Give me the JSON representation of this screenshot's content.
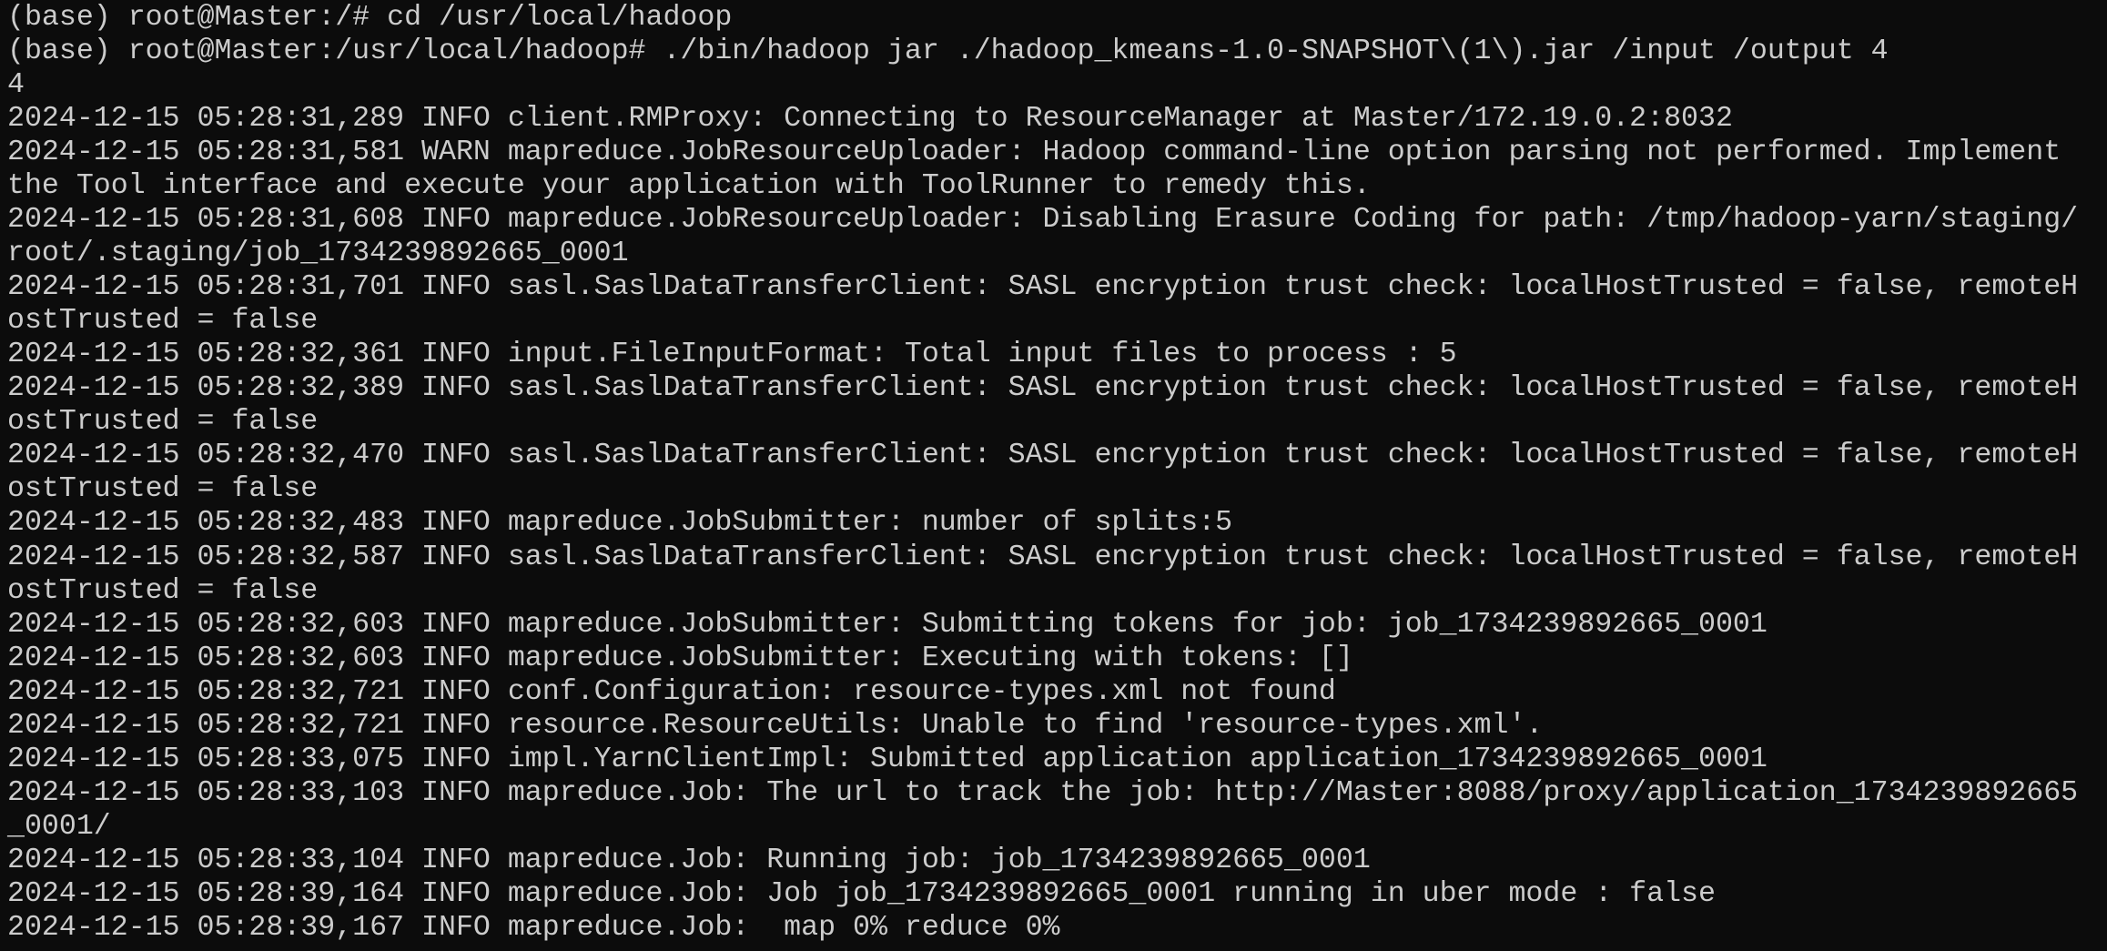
{
  "terminal": {
    "background": "#0c0c0c",
    "foreground": "#cccccc",
    "lines": [
      "(base) root@Master:/# cd /usr/local/hadoop",
      "(base) root@Master:/usr/local/hadoop# ./bin/hadoop jar ./hadoop_kmeans-1.0-SNAPSHOT\\(1\\).jar /input /output 4",
      "4",
      "2024-12-15 05:28:31,289 INFO client.RMProxy: Connecting to ResourceManager at Master/172.19.0.2:8032",
      "2024-12-15 05:28:31,581 WARN mapreduce.JobResourceUploader: Hadoop command-line option parsing not performed. Implement",
      "the Tool interface and execute your application with ToolRunner to remedy this.",
      "2024-12-15 05:28:31,608 INFO mapreduce.JobResourceUploader: Disabling Erasure Coding for path: /tmp/hadoop-yarn/staging/",
      "root/.staging/job_1734239892665_0001",
      "2024-12-15 05:28:31,701 INFO sasl.SaslDataTransferClient: SASL encryption trust check: localHostTrusted = false, remoteH",
      "ostTrusted = false",
      "2024-12-15 05:28:32,361 INFO input.FileInputFormat: Total input files to process : 5",
      "2024-12-15 05:28:32,389 INFO sasl.SaslDataTransferClient: SASL encryption trust check: localHostTrusted = false, remoteH",
      "ostTrusted = false",
      "2024-12-15 05:28:32,470 INFO sasl.SaslDataTransferClient: SASL encryption trust check: localHostTrusted = false, remoteH",
      "ostTrusted = false",
      "2024-12-15 05:28:32,483 INFO mapreduce.JobSubmitter: number of splits:5",
      "2024-12-15 05:28:32,587 INFO sasl.SaslDataTransferClient: SASL encryption trust check: localHostTrusted = false, remoteH",
      "ostTrusted = false",
      "2024-12-15 05:28:32,603 INFO mapreduce.JobSubmitter: Submitting tokens for job: job_1734239892665_0001",
      "2024-12-15 05:28:32,603 INFO mapreduce.JobSubmitter: Executing with tokens: []",
      "2024-12-15 05:28:32,721 INFO conf.Configuration: resource-types.xml not found",
      "2024-12-15 05:28:32,721 INFO resource.ResourceUtils: Unable to find 'resource-types.xml'.",
      "2024-12-15 05:28:33,075 INFO impl.YarnClientImpl: Submitted application application_1734239892665_0001",
      "2024-12-15 05:28:33,103 INFO mapreduce.Job: The url to track the job: http://Master:8088/proxy/application_1734239892665",
      "_0001/",
      "2024-12-15 05:28:33,104 INFO mapreduce.Job: Running job: job_1734239892665_0001",
      "2024-12-15 05:28:39,164 INFO mapreduce.Job: Job job_1734239892665_0001 running in uber mode : false",
      "2024-12-15 05:28:39,167 INFO mapreduce.Job:  map 0% reduce 0%"
    ]
  }
}
